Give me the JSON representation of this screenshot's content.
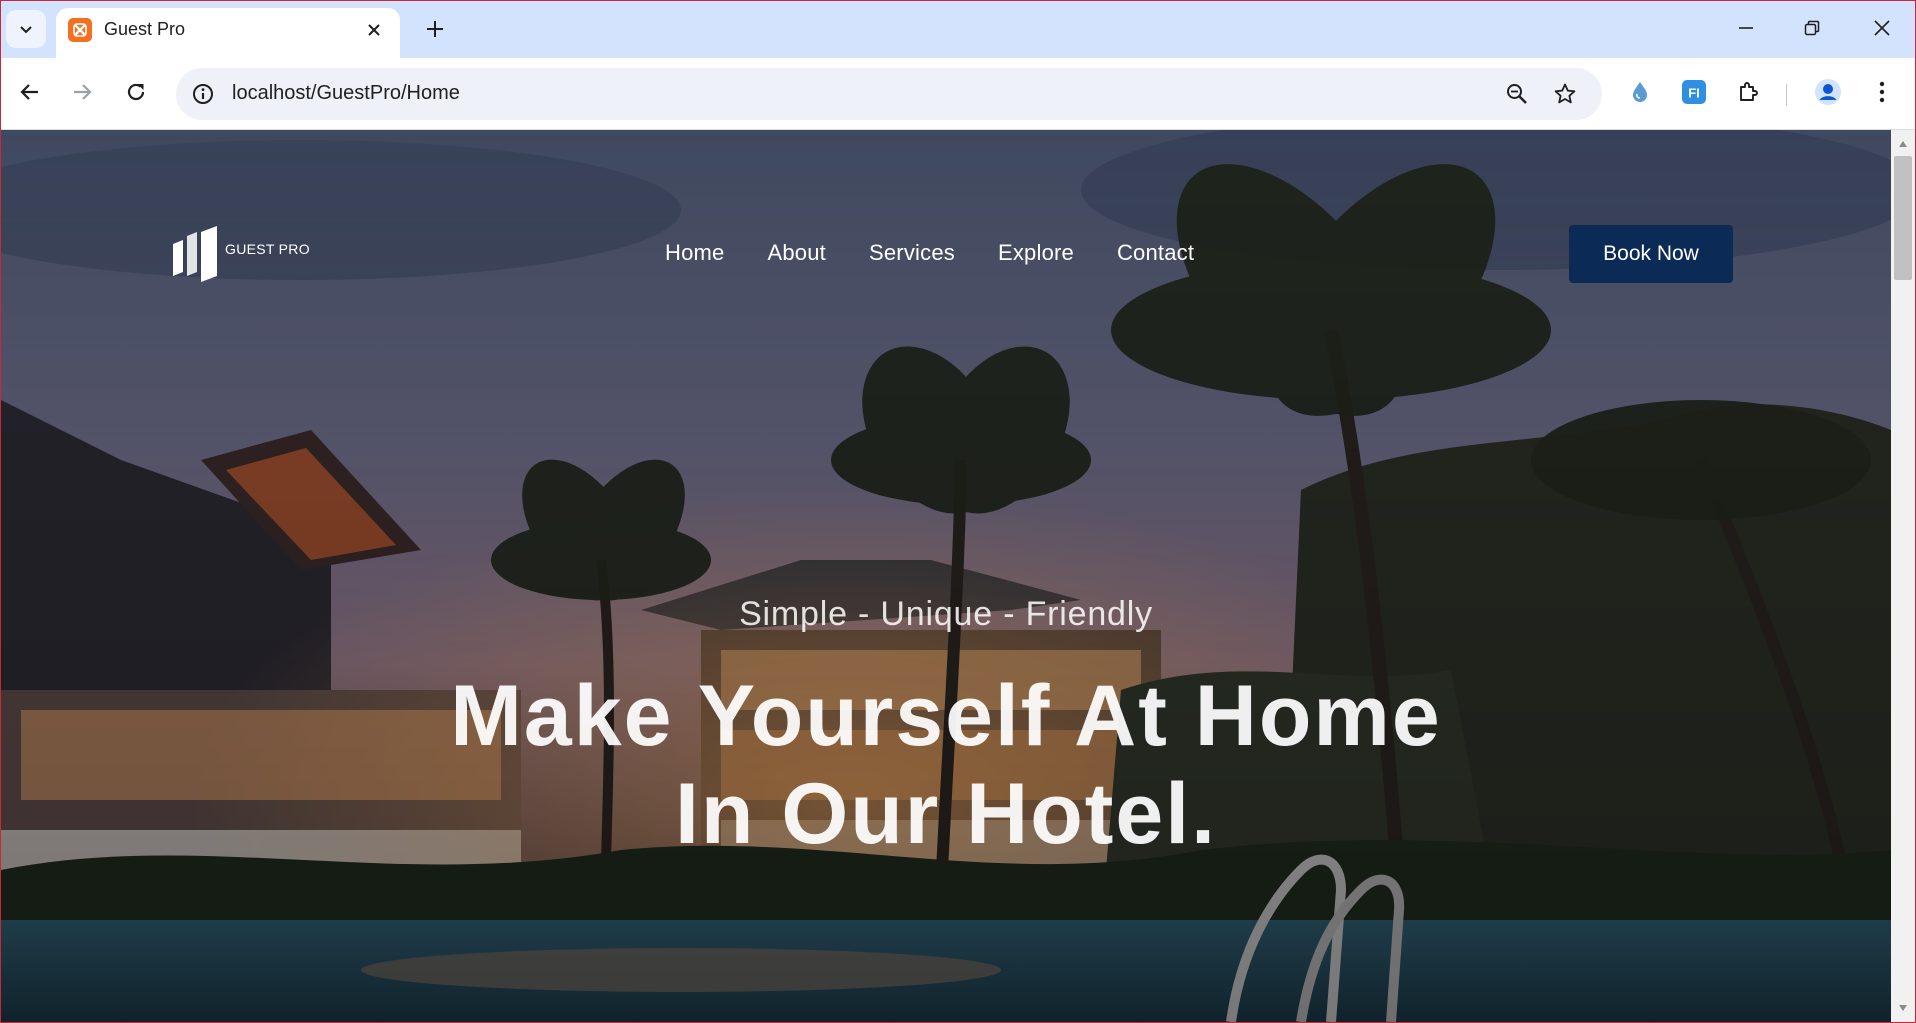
{
  "browser": {
    "tab_title": "Guest Pro",
    "url": "localhost/GuestPro/Home",
    "colors": {
      "tab_strip": "#d3e3fd",
      "favicon": "#f37021",
      "frame": "#c62a3a"
    },
    "icons": [
      "tab-search-icon",
      "xampp-favicon-icon",
      "close-icon",
      "plus-icon",
      "minimize-icon",
      "restore-icon",
      "close-window-icon",
      "back-icon",
      "forward-icon",
      "reload-icon",
      "site-info-icon",
      "zoom-icon",
      "star-icon",
      "extension-drop-icon",
      "extension-fi-icon",
      "puzzle-icon",
      "profile-icon",
      "kebab-menu-icon"
    ],
    "extension_fi_label": "FI"
  },
  "site": {
    "logo_text": "GUEST PRO",
    "nav": [
      {
        "label": "Home"
      },
      {
        "label": "About"
      },
      {
        "label": "Services"
      },
      {
        "label": "Explore"
      },
      {
        "label": "Contact"
      }
    ],
    "cta_label": "Book Now",
    "tagline": "Simple - Unique - Friendly",
    "headline_line1": "Make Yourself At Home",
    "headline_line2": "In Our Hotel.",
    "colors": {
      "cta_background": "#0b2a55",
      "text": "#ffffff"
    }
  }
}
